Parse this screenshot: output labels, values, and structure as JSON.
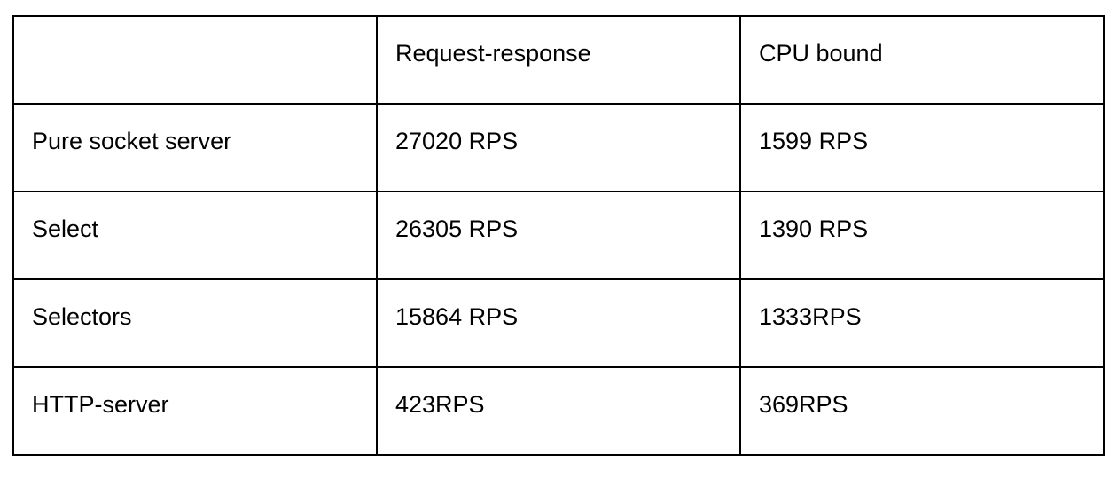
{
  "table": {
    "header": [
      "",
      "Request-response",
      "CPU bound"
    ],
    "rows": [
      [
        "Pure socket server",
        "27020 RPS",
        "1599 RPS"
      ],
      [
        "Select",
        "26305 RPS",
        "1390 RPS"
      ],
      [
        "Selectors",
        "15864 RPS",
        "1333RPS"
      ],
      [
        "HTTP-server",
        "423RPS",
        "369RPS"
      ]
    ]
  }
}
